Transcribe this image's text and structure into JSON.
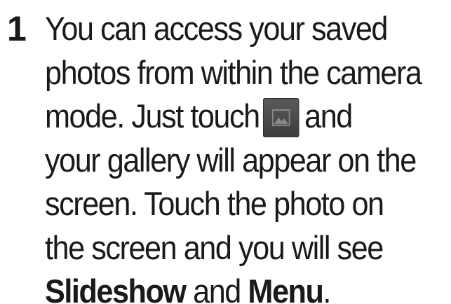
{
  "step": {
    "number": "1",
    "line1": "You can access your saved",
    "line2": "photos from within the camera",
    "line3_before_icon": "mode. Just touch",
    "line3_after_icon": "and",
    "icon": "gallery-icon",
    "line4": "your gallery will appear on the",
    "line5": "screen. Touch the photo on",
    "line6": "the screen and you will see",
    "line7_bold1": "Slideshow",
    "line7_middle": "and",
    "line7_bold2": "Menu",
    "line7_end": "."
  }
}
